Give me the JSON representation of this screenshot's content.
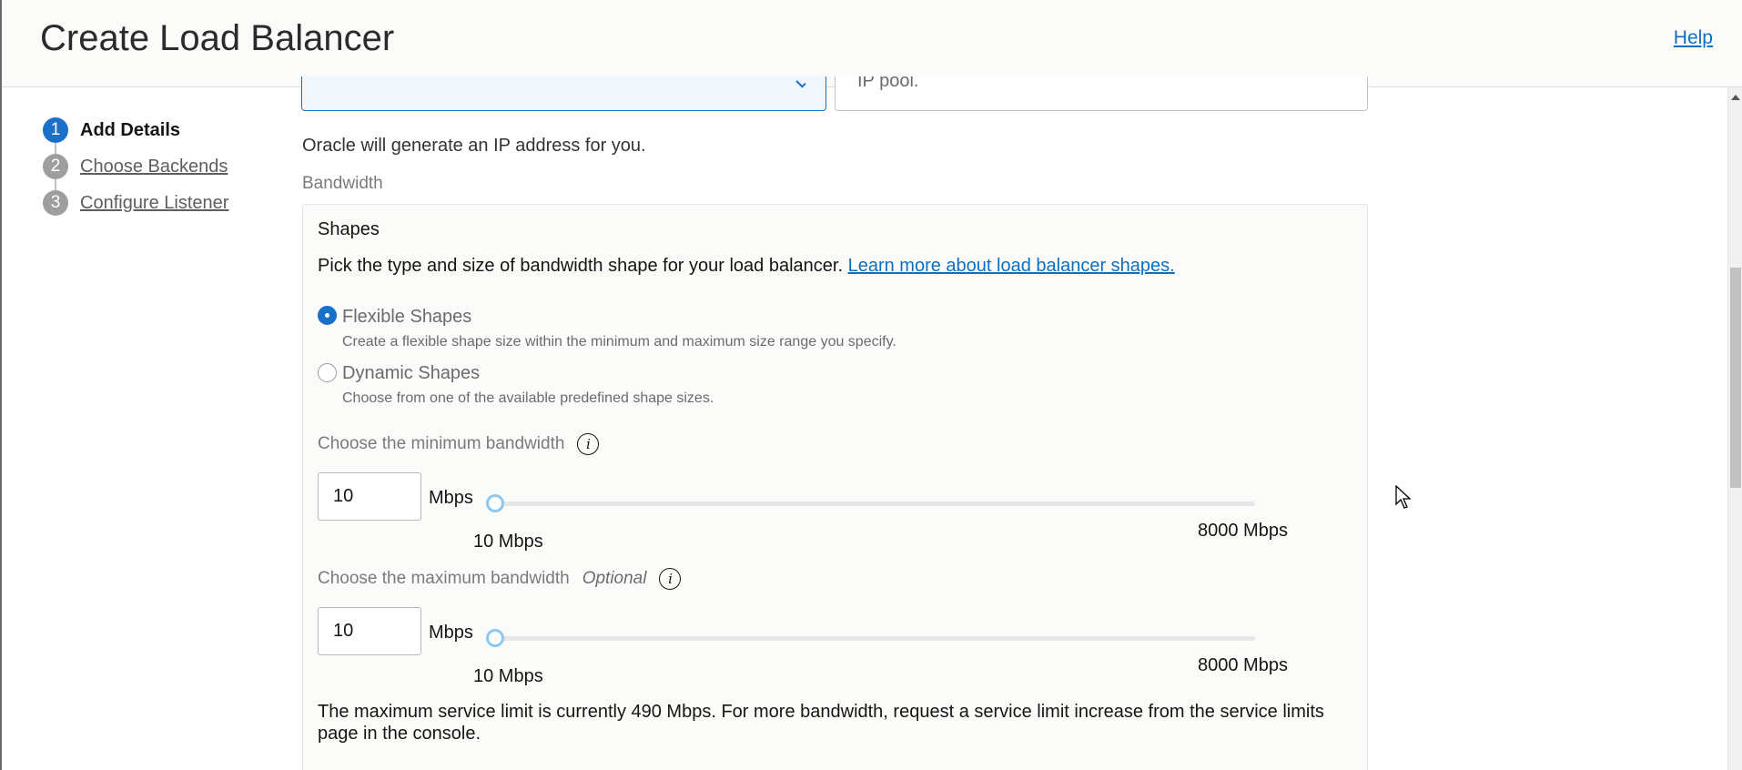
{
  "header": {
    "title": "Create Load Balancer",
    "help_label": "Help"
  },
  "steps": [
    {
      "number": "1",
      "label": "Add Details",
      "state": "active"
    },
    {
      "number": "2",
      "label": "Choose Backends",
      "state": "inactive"
    },
    {
      "number": "3",
      "label": "Configure Listener",
      "state": "inactive"
    }
  ],
  "top_fields": {
    "ip_pool_partial_text": "IP pool."
  },
  "ip_note": "Oracle will generate an IP address for you.",
  "bandwidth": {
    "section_label": "Bandwidth",
    "shapes_title": "Shapes",
    "shapes_description": "Pick the type and size of bandwidth shape for your load balancer.",
    "shapes_link": "Learn more about load balancer shapes.",
    "options": [
      {
        "label": "Flexible Shapes",
        "description": "Create a flexible shape size within the minimum and maximum size range you specify.",
        "selected": true
      },
      {
        "label": "Dynamic Shapes",
        "description": "Choose from one of the available predefined shape sizes.",
        "selected": false
      }
    ],
    "min": {
      "label": "Choose the minimum bandwidth",
      "value": "10",
      "unit": "Mbps",
      "range_min_label": "10 Mbps",
      "range_max_label": "8000 Mbps",
      "slider_fraction": 0
    },
    "max": {
      "label": "Choose the maximum bandwidth",
      "optional_label": "Optional",
      "value": "10",
      "unit": "Mbps",
      "range_min_label": "10 Mbps",
      "range_max_label": "8000 Mbps",
      "slider_fraction": 0
    },
    "limit_note": "The maximum service limit is currently 490 Mbps. For more bandwidth, request a service limit increase from the service limits page in the console."
  },
  "colors": {
    "accent": "#1a6fc6",
    "link": "#0f6fbf",
    "slider_thumb": "#8ec8ef"
  }
}
